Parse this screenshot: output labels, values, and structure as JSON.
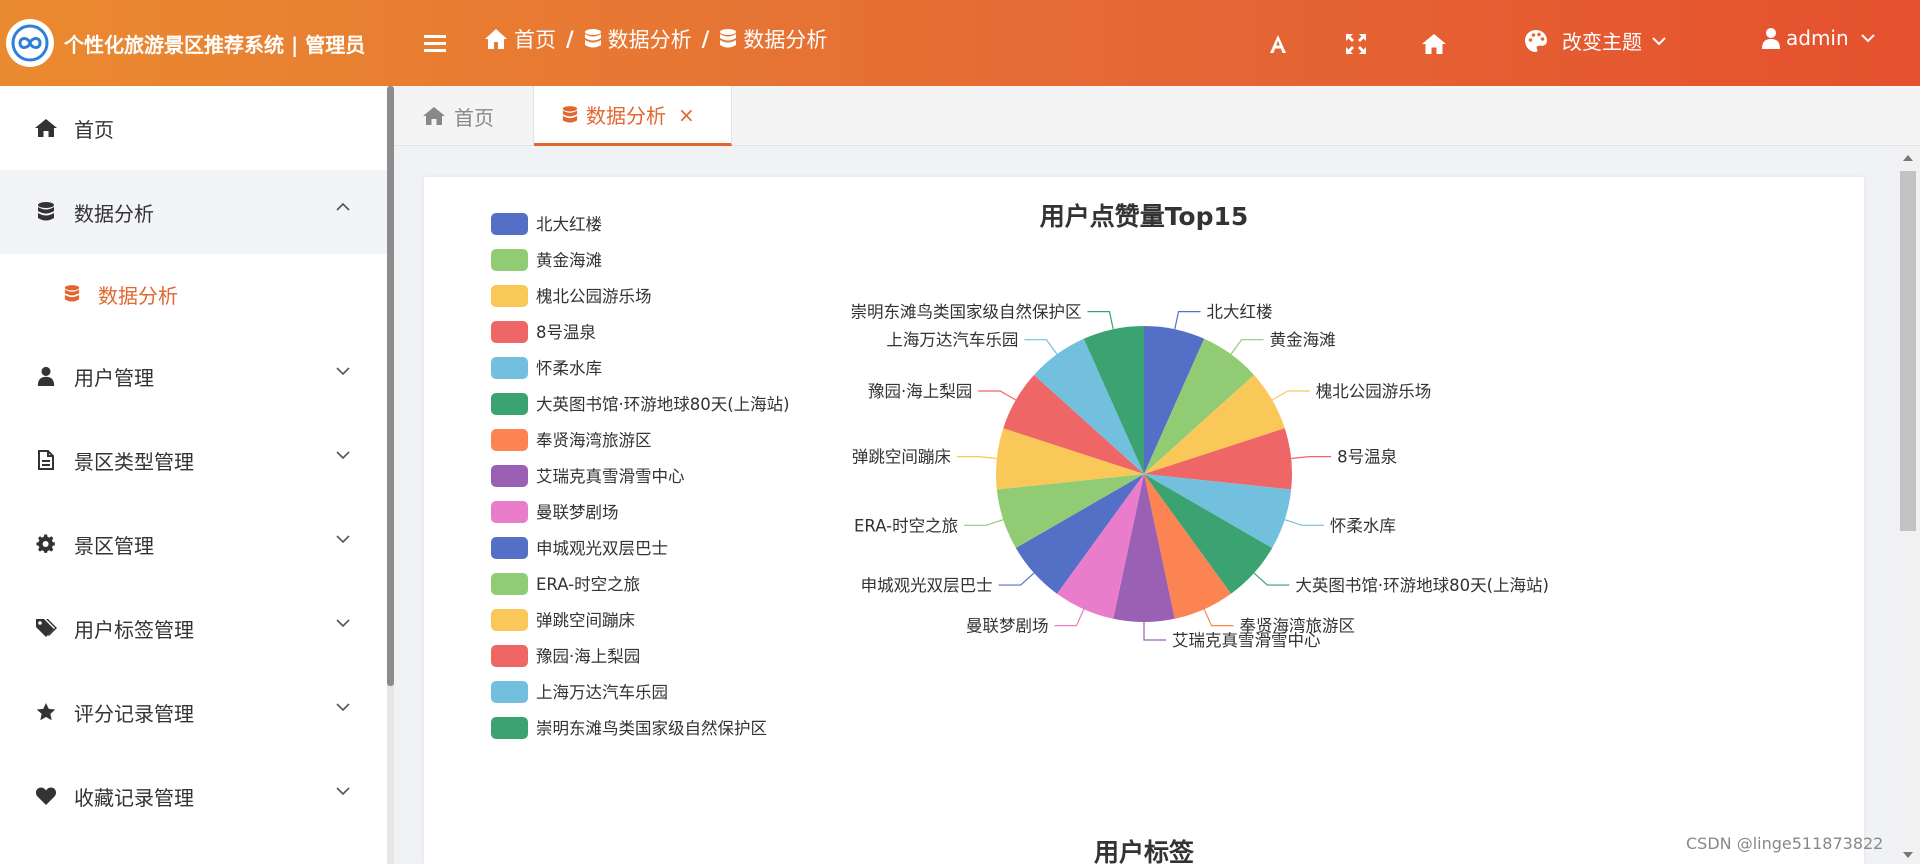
{
  "header": {
    "title": "个性化旅游景区推荐系统 | 管理员",
    "breadcrumb": [
      "首页",
      "数据分析",
      "数据分析"
    ],
    "font_icon": "font-size-icon",
    "theme_label": "改变主题",
    "user_name": "admin"
  },
  "sidebar": {
    "items": [
      {
        "label": "首页",
        "icon": "home-icon"
      },
      {
        "label": "数据分析",
        "icon": "database-icon",
        "open": true
      },
      {
        "label": "用户管理",
        "icon": "user-icon"
      },
      {
        "label": "景区类型管理",
        "icon": "document-icon"
      },
      {
        "label": "景区管理",
        "icon": "gear-icon"
      },
      {
        "label": "用户标签管理",
        "icon": "tags-icon"
      },
      {
        "label": "评分记录管理",
        "icon": "star-icon"
      },
      {
        "label": "收藏记录管理",
        "icon": "heart-icon"
      }
    ],
    "submenu": [
      {
        "label": "数据分析",
        "icon": "database-icon"
      }
    ]
  },
  "tabs": [
    {
      "label": "首页",
      "close": ""
    },
    {
      "label": "数据分析",
      "close": "×"
    }
  ],
  "colors": {
    "accent": "#e2672f",
    "header_start": "#ea8a30",
    "header_end": "#e5502e",
    "palette": [
      "#5470c6",
      "#91cc75",
      "#fac858",
      "#ee6666",
      "#73c0de",
      "#3ba272",
      "#fc8452",
      "#9a60b4",
      "#ea7ccc"
    ]
  },
  "chart_data": {
    "type": "pie",
    "title": "用户点赞量Top15",
    "categories": [
      "北大红楼",
      "黄金海滩",
      "槐北公园游乐场",
      "8号温泉",
      "怀柔水库",
      "大英图书馆·环游地球80天(上海站)",
      "奉贤海湾旅游区",
      "艾瑞克真雪滑雪中心",
      "曼联梦剧场",
      "申城观光双层巴士",
      "ERA-时空之旅",
      "弹跳空间蹦床",
      "豫园·海上梨园",
      "上海万达汽车乐园",
      "崇明东滩鸟类国家级自然保护区"
    ],
    "values": [
      1,
      1,
      1,
      1,
      1,
      1,
      1,
      1,
      1,
      1,
      1,
      1,
      1,
      1,
      1
    ],
    "legend_position": "left"
  },
  "section2": {
    "title": "用户标签"
  },
  "watermark": "CSDN @linge511873822"
}
